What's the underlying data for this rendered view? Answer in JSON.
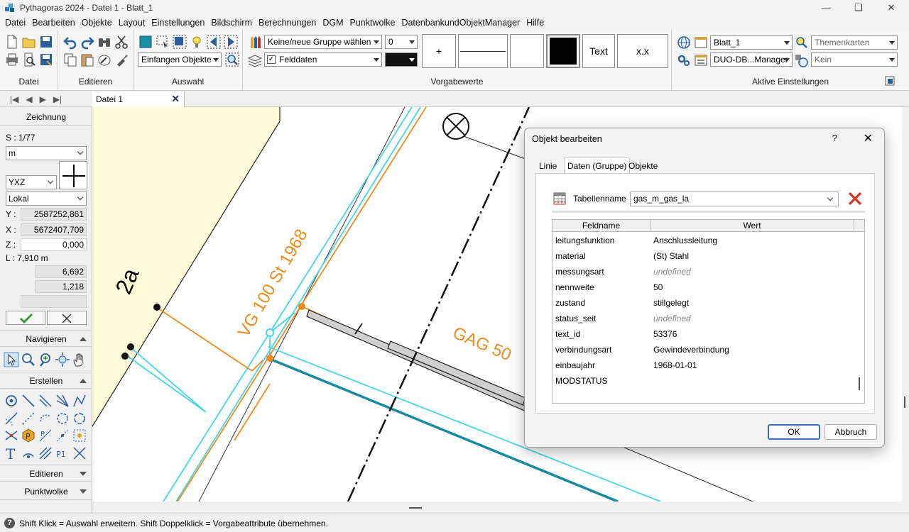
{
  "window": {
    "title": "Pythagoras 2024 - Datei 1 - Blatt_1",
    "minimize_icon": "minimize-icon",
    "maximize_icon": "restore-icon",
    "close_icon": "close-icon"
  },
  "menu": [
    "Datei",
    "Bearbeiten",
    "Objekte",
    "Layout",
    "Einstellungen",
    "Bildschirm",
    "Berechnungen",
    "DGM",
    "Punktwolke",
    "DatenbankundObjektManager",
    "Hilfe"
  ],
  "ribbon": {
    "groups": {
      "datei": "Datei",
      "editieren": "Editieren",
      "auswahl": "Auswahl",
      "vorgabewerte": "Vorgabewerte",
      "aktive": "Aktive Einstellungen"
    },
    "auswahl_combo": "Einfangen Objekte",
    "gruppe_combo": "Keine/neue Gruppe wählen",
    "felddaten_combo": "Felddaten",
    "layer_num": "0",
    "colors": {
      "black": "#000000",
      "teal": "#1a8fa8"
    },
    "vbox_plus": "+",
    "vbox_text": "Text",
    "vbox_xx": "x.x",
    "blatt_combo": "Blatt_1",
    "duo_combo": "DUO-DB...Manager",
    "themen_combo": "Themenkarten",
    "kein_combo": "Kein"
  },
  "tabs": {
    "doc": "Datei 1"
  },
  "left": {
    "zeichnung": "Zeichnung",
    "scale": "S : 1/77",
    "unit": "m",
    "axes": "YXZ",
    "coord_sys": "Lokal",
    "y_label": "Y :",
    "y_value": "2587252,861",
    "x_label": "X :",
    "x_value": "5672407,709",
    "z_label": "Z :",
    "z_value": "0,000",
    "length": "L : 7,910 m",
    "v1": "6,692",
    "v2": "1,218",
    "navigieren": "Navigieren",
    "erstellen": "Erstellen",
    "editieren": "Editieren",
    "punktwolke": "Punktwolke"
  },
  "canvas": {
    "label_2a": "2a",
    "label_vg": "VG 100 St 1968",
    "label_gag": "GAG 50"
  },
  "dialog": {
    "title": "Objekt bearbeiten",
    "help": "?",
    "tabs": [
      "Linie",
      "Daten (Gruppe)",
      "Objekte"
    ],
    "table_label": "Tabellenname",
    "table_value": "gas_m_gas_la",
    "col_feld": "Feldname",
    "col_wert": "Wert",
    "rows": [
      {
        "feld": "leitungsfunktion",
        "wert": "Anschlussleitung"
      },
      {
        "feld": "material",
        "wert": "(St) Stahl"
      },
      {
        "feld": "messungsart",
        "wert": "undefined"
      },
      {
        "feld": "nennweite",
        "wert": "50"
      },
      {
        "feld": "zustand",
        "wert": "stillgelegt"
      },
      {
        "feld": "status_seit",
        "wert": "undefined"
      },
      {
        "feld": "text_id",
        "wert": "53376"
      },
      {
        "feld": "verbindungsart",
        "wert": "Gewindeverbindung"
      },
      {
        "feld": "einbaujahr",
        "wert": "1968-01-01"
      },
      {
        "feld": "MODSTATUS",
        "wert": ""
      }
    ],
    "ok": "OK",
    "cancel": "Abbruch"
  },
  "status": {
    "text": "Shift Klick = Auswahl erweitern. Shift Doppelklick = Vorgabeattribute übernehmen."
  }
}
